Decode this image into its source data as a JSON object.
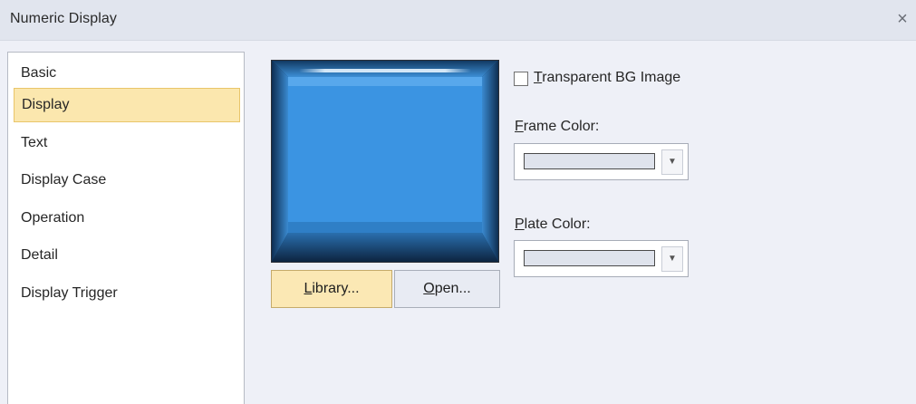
{
  "window": {
    "title": "Numeric Display",
    "close_glyph": "×"
  },
  "sidebar": {
    "items": [
      {
        "label": "Basic"
      },
      {
        "label": "Display",
        "selected": true
      },
      {
        "label": "Text"
      },
      {
        "label": "Display Case"
      },
      {
        "label": "Operation"
      },
      {
        "label": "Detail"
      },
      {
        "label": "Display Trigger"
      }
    ]
  },
  "preview": {
    "icon": "blue-display-frame-image",
    "primary_color": "#3b94e2"
  },
  "buttons": {
    "library": {
      "mnemonic": "L",
      "rest": "ibrary..."
    },
    "open": {
      "mnemonic": "O",
      "rest": "pen..."
    }
  },
  "options": {
    "transparent_bg": {
      "mnemonic": "T",
      "rest": "ransparent BG Image",
      "checked": false
    },
    "frame_color": {
      "mnemonic": "F",
      "rest": "rame Color:",
      "value": "#dfe3ec"
    },
    "plate_color": {
      "mnemonic": "P",
      "rest": "late Color:",
      "value": "#dfe3ec"
    }
  },
  "colors": {
    "selected_bg": "#fbe7ae",
    "selected_border": "#e9c56a",
    "dialog_bg": "#eef0f7",
    "titlebar_bg": "#e1e5ee"
  }
}
